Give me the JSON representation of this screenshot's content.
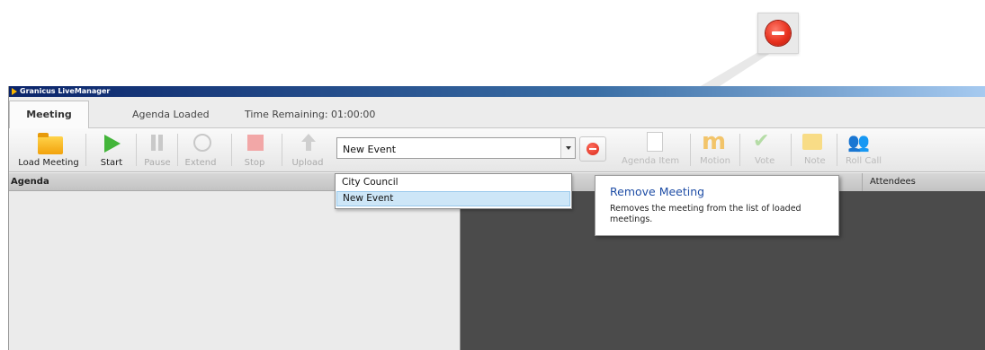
{
  "app": {
    "title": "Granicus LiveManager"
  },
  "tabs": {
    "meeting": "Meeting"
  },
  "status": {
    "agenda": "Agenda Loaded",
    "time": "Time Remaining: 01:00:00"
  },
  "toolbar": {
    "load_meeting": "Load Meeting",
    "start": "Start",
    "pause": "Pause",
    "extend": "Extend",
    "stop": "Stop",
    "upload": "Upload",
    "agenda_item": "Agenda Item",
    "motion": "Motion",
    "vote": "Vote",
    "note": "Note",
    "roll_call": "Roll Call"
  },
  "meeting_select": {
    "value": "New Event",
    "options": [
      "City Council",
      "New Event"
    ]
  },
  "panels": {
    "agenda": "Agenda",
    "attendees": "Attendees"
  },
  "tooltip": {
    "title": "Remove Meeting",
    "description": "Removes the meeting from the list of loaded meetings."
  },
  "icons": {
    "remove": "remove-minus-circle-icon",
    "load": "folder-icon",
    "start": "play-icon",
    "pause": "pause-icon",
    "extend": "clock-icon",
    "stop": "stop-icon",
    "upload": "upload-arrow-icon"
  },
  "colors": {
    "titlebar": "#0a246a",
    "remove": "#e8321f",
    "start": "#43b53a"
  }
}
